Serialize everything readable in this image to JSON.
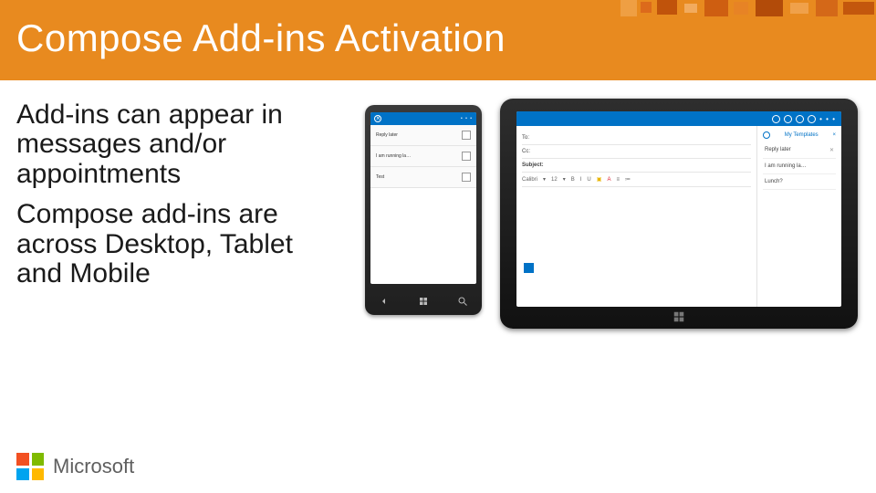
{
  "colors": {
    "accent": "#e88a1f",
    "link": "#0072c6"
  },
  "header": {
    "title": "Compose Add-ins Activation"
  },
  "body": {
    "para1": "Add-ins can appear in messages and/or appointments",
    "para2": "Compose add-ins are across Desktop, Tablet and Mobile"
  },
  "footer": {
    "brand": "Microsoft"
  },
  "phone": {
    "menu_dots": "• • •",
    "rows": [
      {
        "label": "Reply later"
      },
      {
        "label": "I am running la…"
      },
      {
        "label": "Test"
      }
    ]
  },
  "tablet": {
    "menu_dots": "• • •",
    "compose": {
      "to_label": "To:",
      "cc_label": "Cc:",
      "subject_label": "Subject:",
      "font_name": "Calibri",
      "font_size": "12",
      "bold": "B",
      "italic": "I",
      "underline": "U"
    },
    "sidepane": {
      "title": "My Templates",
      "close": "×",
      "items": [
        {
          "title": "Reply later",
          "del": "✕"
        },
        {
          "title": "I am running la…",
          "del": ""
        },
        {
          "title": "Lunch?",
          "del": ""
        }
      ]
    }
  }
}
